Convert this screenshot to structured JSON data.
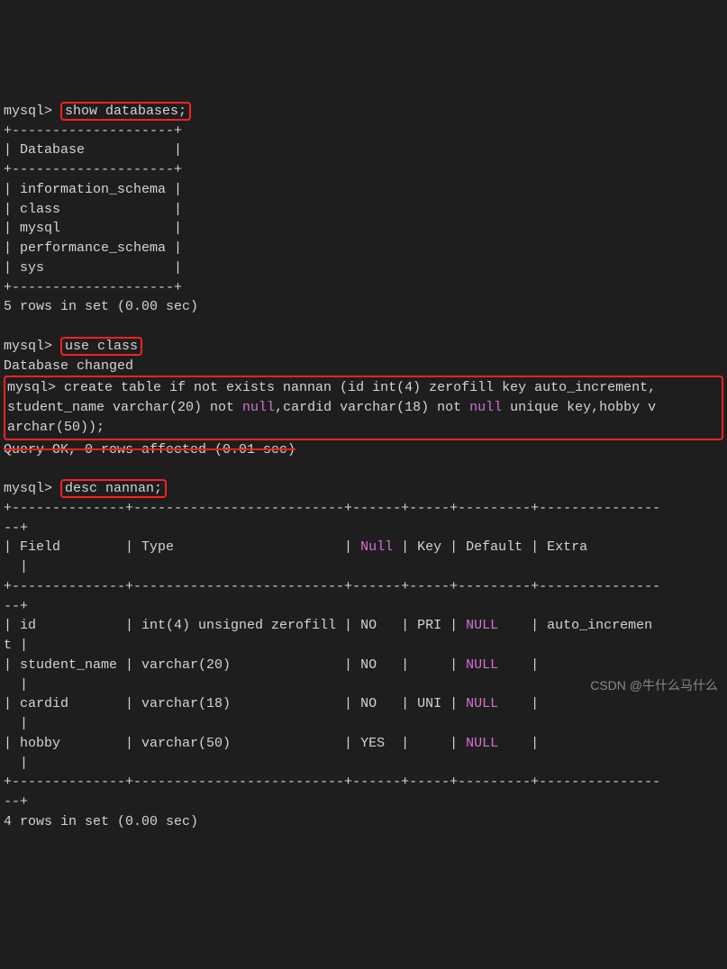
{
  "prompt": "mysql>",
  "cmd_show_databases": "show databases;",
  "table_sep_top": "+--------------------+",
  "db_header": "| Database           |",
  "databases": [
    "| information_schema |",
    "| class              |",
    "| mysql              |",
    "| performance_schema |",
    "| sys                |"
  ],
  "rows_result_1": "5 rows in set (0.00 sec)",
  "cmd_use_class": "use class",
  "db_changed": "Database changed",
  "create_line_1_a": "mysql> create table if not exists nannan (id int(4) zerofill key auto_increment,",
  "create_line_2_a": "student_name varchar(20) not ",
  "create_line_2_null1": "null",
  "create_line_2_b": ",cardid varchar(18) not ",
  "create_line_2_null2": "null",
  "create_line_2_c": " unique key,hobby v",
  "create_line_3": "archar(50));",
  "query_ok": "Query OK, 0 rows affected (0.01 sec)",
  "cmd_desc": "desc nannan;",
  "desc_sep": "+--------------+--------------------------+------+-----+---------+---------------",
  "desc_sep_end": "--+",
  "desc_header_a": "| Field        | Type                     | ",
  "desc_header_null": "Null",
  "desc_header_b": " | Key | Default | Extra         ",
  "desc_header_end": "  |",
  "row_id_a": "| id           | int(4) unsigned zerofill | NO   | PRI | ",
  "row_id_null": "NULL",
  "row_id_b": "    | auto_incremen",
  "row_id_end": "t |",
  "row_sname_a": "| student_name | varchar(20)              | NO   |     | ",
  "row_sname_null": "NULL",
  "row_sname_b": "    |               ",
  "row_end": "  |",
  "row_cardid_a": "| cardid       | varchar(18)              | NO   | UNI | ",
  "row_cardid_null": "NULL",
  "row_cardid_b": "    |               ",
  "row_hobby_a": "| hobby        | varchar(50)              | YES  |     | ",
  "row_hobby_null": "NULL",
  "row_hobby_b": "    |               ",
  "rows_result_2": "4 rows in set (0.00 sec)",
  "watermark": "CSDN @牛什么马什么"
}
